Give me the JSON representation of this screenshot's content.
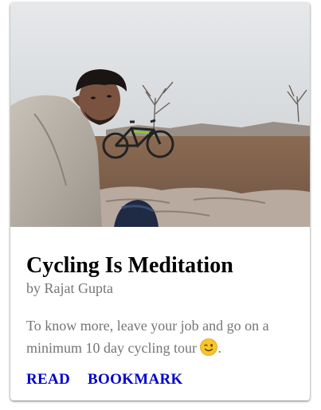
{
  "card": {
    "image_alt": "Man taking a selfie next to a bicycle in a rocky field",
    "title": "Cycling Is Meditation",
    "author": "by Rajat Gupta",
    "description": "To know more, leave your job and go on a minimum 10 day cycling tour",
    "description_end": ".",
    "emoji": "winking-face-icon",
    "actions": {
      "read_label": "READ",
      "bookmark_label": "BOOKMARK"
    }
  },
  "colors": {
    "title": "#000000",
    "secondary_text": "#757575",
    "action_link": "#0000cc",
    "card_background": "#ffffff"
  }
}
